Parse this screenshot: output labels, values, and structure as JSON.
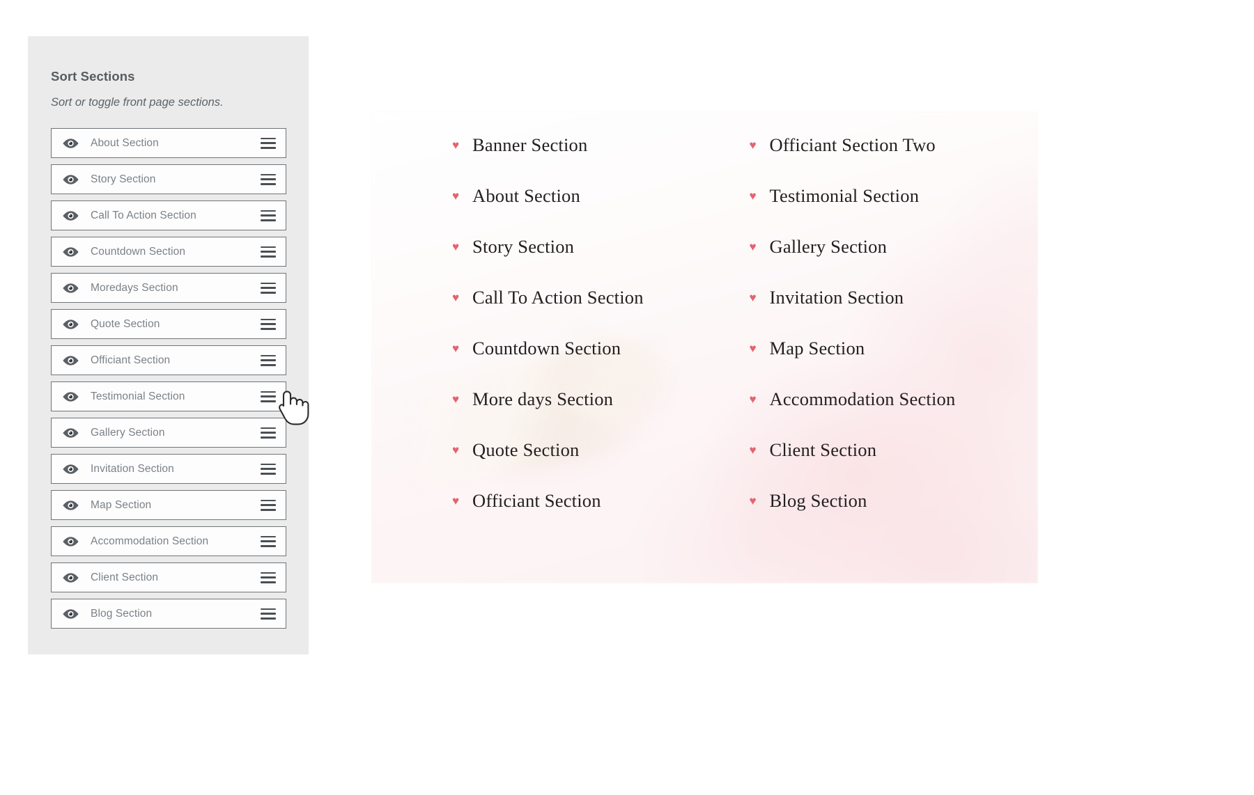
{
  "sidebar": {
    "title": "Sort Sections",
    "subtitle": "Sort or toggle front page sections.",
    "eye_icon": "eye-icon",
    "drag_icon": "hamburger-drag-handle-icon",
    "items": [
      {
        "label": "About Section"
      },
      {
        "label": "Story Section"
      },
      {
        "label": "Call To Action Section"
      },
      {
        "label": "Countdown Section"
      },
      {
        "label": "Moredays Section"
      },
      {
        "label": "Quote Section"
      },
      {
        "label": "Officiant Section"
      },
      {
        "label": "Testimonial Section"
      },
      {
        "label": "Gallery Section"
      },
      {
        "label": "Invitation Section"
      },
      {
        "label": "Map Section"
      },
      {
        "label": "Accommodation Section"
      },
      {
        "label": "Client Section"
      },
      {
        "label": "Blog Section"
      }
    ]
  },
  "cursor": {
    "icon": "hand-pointer-cursor",
    "hovered_item": "Testimonial Section"
  },
  "preview": {
    "bullet_icon": "heart-icon",
    "bullet_glyph": "♥",
    "accent_color": "#e4636f",
    "text_color": "#231f20",
    "background_color": "#fdf8f8",
    "columns": [
      {
        "items": [
          {
            "label": "Banner Section"
          },
          {
            "label": "About Section"
          },
          {
            "label": "Story Section"
          },
          {
            "label": "Call To Action Section"
          },
          {
            "label": "Countdown Section"
          },
          {
            "label": "More days Section"
          },
          {
            "label": "Quote Section"
          },
          {
            "label": "Officiant Section"
          }
        ]
      },
      {
        "items": [
          {
            "label": "Officiant Section Two"
          },
          {
            "label": "Testimonial Section"
          },
          {
            "label": "Gallery Section"
          },
          {
            "label": "Invitation Section"
          },
          {
            "label": "Map Section"
          },
          {
            "label": "Accommodation Section"
          },
          {
            "label": "Client Section"
          },
          {
            "label": "Blog Section"
          }
        ]
      }
    ]
  }
}
